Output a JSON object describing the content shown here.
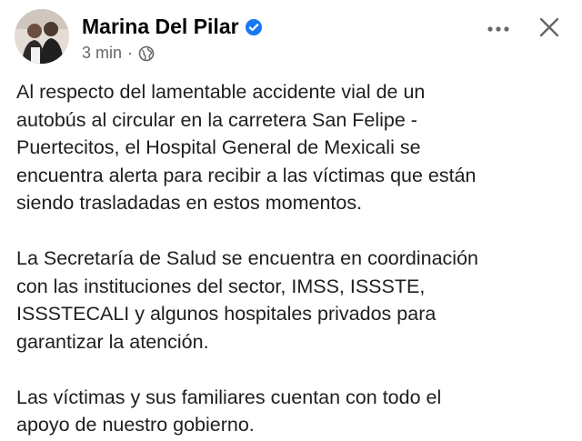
{
  "post": {
    "author_name": "Marina Del Pilar",
    "time": "3 min",
    "separator": "·",
    "icons": {
      "verified": "verified-badge-icon",
      "audience": "globe-icon",
      "more": "more-horizontal-icon",
      "close": "close-icon"
    },
    "colors": {
      "verified_blue": "#1877f2",
      "meta_gray": "#65676b",
      "text": "#1c1e21"
    },
    "paragraphs": [
      "Al respecto del lamentable accidente vial de un\nautobús al circular en la carretera San Felipe -\nPuertecitos, el Hospital General de Mexicali se\nencuentra alerta para recibir a las víctimas que están\nsiendo trasladadas en estos momentos.",
      "La Secretaría de Salud se encuentra en coordinación\ncon las instituciones del sector, IMSS, ISSSTE,\nISSSTECALI y algunos hospitales privados para\ngarantizar la atención.",
      "Las víctimas y sus familiares cuentan con todo el\napoyo de nuestro gobierno."
    ]
  }
}
